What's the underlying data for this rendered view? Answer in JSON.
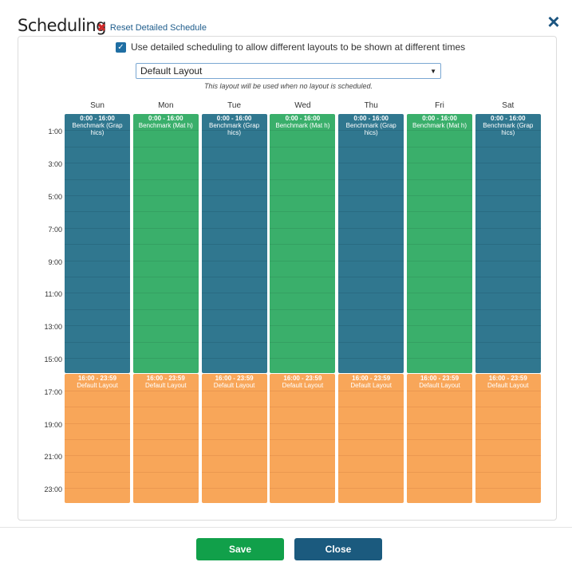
{
  "dialog": {
    "title": "Scheduling",
    "reset_label": "Reset Detailed Schedule",
    "close_icon": "×"
  },
  "options": {
    "detailed_checkbox_label": "Use detailed scheduling to allow different layouts to be shown at different times",
    "detailed_checked": true,
    "layout_select_value": "Default Layout",
    "layout_hint": "This layout will be used when no layout is scheduled."
  },
  "colors": {
    "blue": "#30778f",
    "blue_line": "#2a6b82",
    "green": "#3aaf6b",
    "green_line": "#35a062",
    "orange": "#f8a659",
    "orange_line": "#eb9850"
  },
  "calendar": {
    "hour_labels": [
      "1:00",
      "3:00",
      "5:00",
      "7:00",
      "9:00",
      "11:00",
      "13:00",
      "15:00",
      "17:00",
      "19:00",
      "21:00",
      "23:00"
    ],
    "days": [
      {
        "label": "Sun",
        "blocks": [
          {
            "time": "0:00 - 16:00",
            "name": "Benchmark (Grap hics)",
            "color": "blue"
          },
          {
            "time": "16:00 - 23:59",
            "name": "Default Layout",
            "color": "orange"
          }
        ]
      },
      {
        "label": "Mon",
        "blocks": [
          {
            "time": "0:00 - 16:00",
            "name": "Benchmark (Mat h)",
            "color": "green"
          },
          {
            "time": "16:00 - 23:59",
            "name": "Default Layout",
            "color": "orange"
          }
        ]
      },
      {
        "label": "Tue",
        "blocks": [
          {
            "time": "0:00 - 16:00",
            "name": "Benchmark (Grap hics)",
            "color": "blue"
          },
          {
            "time": "16:00 - 23:59",
            "name": "Default Layout",
            "color": "orange"
          }
        ]
      },
      {
        "label": "Wed",
        "blocks": [
          {
            "time": "0:00 - 16:00",
            "name": "Benchmark (Mat h)",
            "color": "green"
          },
          {
            "time": "16:00 - 23:59",
            "name": "Default Layout",
            "color": "orange"
          }
        ]
      },
      {
        "label": "Thu",
        "blocks": [
          {
            "time": "0:00 - 16:00",
            "name": "Benchmark (Grap hics)",
            "color": "blue"
          },
          {
            "time": "16:00 - 23:59",
            "name": "Default Layout",
            "color": "orange"
          }
        ]
      },
      {
        "label": "Fri",
        "blocks": [
          {
            "time": "0:00 - 16:00",
            "name": "Benchmark (Mat h)",
            "color": "green"
          },
          {
            "time": "16:00 - 23:59",
            "name": "Default Layout",
            "color": "orange"
          }
        ]
      },
      {
        "label": "Sat",
        "blocks": [
          {
            "time": "0:00 - 16:00",
            "name": "Benchmark (Grap hics)",
            "color": "blue"
          },
          {
            "time": "16:00 - 23:59",
            "name": "Default Layout",
            "color": "orange"
          }
        ]
      }
    ]
  },
  "footer": {
    "save_label": "Save",
    "close_label": "Close"
  }
}
